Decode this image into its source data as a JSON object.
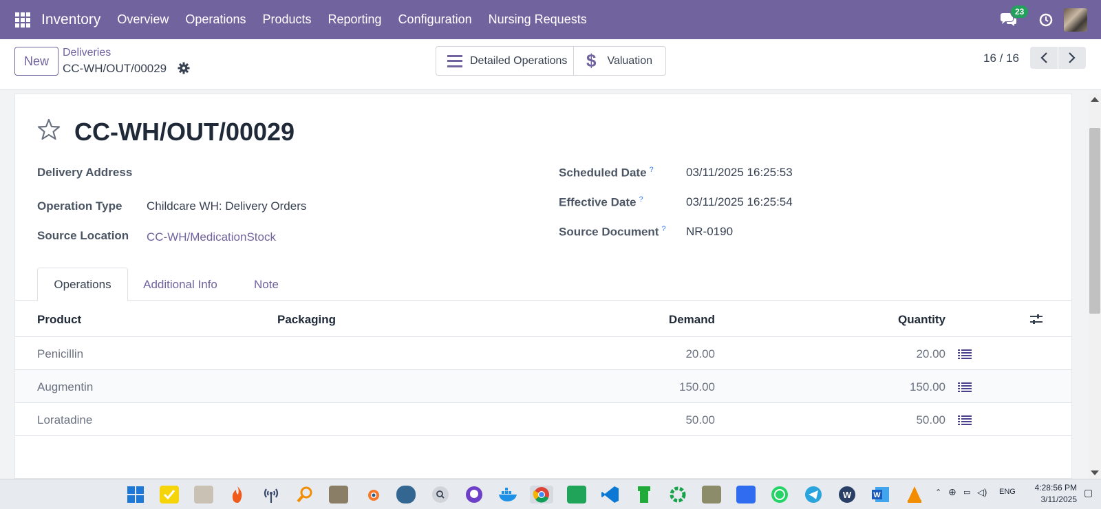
{
  "navbar": {
    "brand": "Inventory",
    "menu": [
      "Overview",
      "Operations",
      "Products",
      "Reporting",
      "Configuration",
      "Nursing Requests"
    ],
    "chat_count": "23",
    "color": "#71639e"
  },
  "control": {
    "new_label": "New",
    "breadcrumb_parent": "Deliveries",
    "breadcrumb_current": "CC-WH/OUT/00029",
    "smart_buttons": {
      "detailed": "Detailed Operations",
      "valuation": "Valuation"
    },
    "pager": "16 / 16"
  },
  "record": {
    "title": "CC-WH/OUT/00029",
    "fields_left": [
      {
        "label": "Delivery Address",
        "value": ""
      },
      {
        "label": "Operation Type",
        "value": "Childcare WH: Delivery Orders"
      },
      {
        "label": "Source Location",
        "value": "CC-WH/MedicationStock"
      }
    ],
    "fields_right": [
      {
        "label": "Scheduled Date",
        "help": "?",
        "value": "03/11/2025 16:25:53"
      },
      {
        "label": "Effective Date",
        "help": "?",
        "value": "03/11/2025 16:25:54"
      },
      {
        "label": "Source Document",
        "help": "?",
        "value": "NR-0190"
      }
    ]
  },
  "tabs": [
    "Operations",
    "Additional Info",
    "Note"
  ],
  "table": {
    "columns": {
      "product": "Product",
      "packaging": "Packaging",
      "demand": "Demand",
      "quantity": "Quantity"
    },
    "rows": [
      {
        "product": "Penicillin",
        "demand": "20.00",
        "quantity": "20.00"
      },
      {
        "product": "Augmentin",
        "demand": "150.00",
        "quantity": "150.00"
      },
      {
        "product": "Loratadine",
        "demand": "50.00",
        "quantity": "50.00"
      }
    ]
  },
  "taskbar": {
    "lang": "ENG",
    "time": "4:28:56 PM",
    "date": "3/11/2025",
    "icons": [
      "windows-start-icon",
      "sticky-notes-icon",
      "file-explorer-icon",
      "flame-icon",
      "wifi-tool-icon",
      "search-tool-icon",
      "gimp-icon",
      "blender-icon",
      "postgres-icon",
      "search-circle-icon",
      "github-icon",
      "docker-icon",
      "chrome-icon",
      "screen-capture-icon",
      "vscode-icon",
      "pipe-icon",
      "gear-app-icon",
      "ship-icon",
      "grid-app-icon",
      "whatsapp-icon",
      "telegram-icon",
      "wps-icon",
      "word-icon",
      "vlc-icon"
    ]
  }
}
